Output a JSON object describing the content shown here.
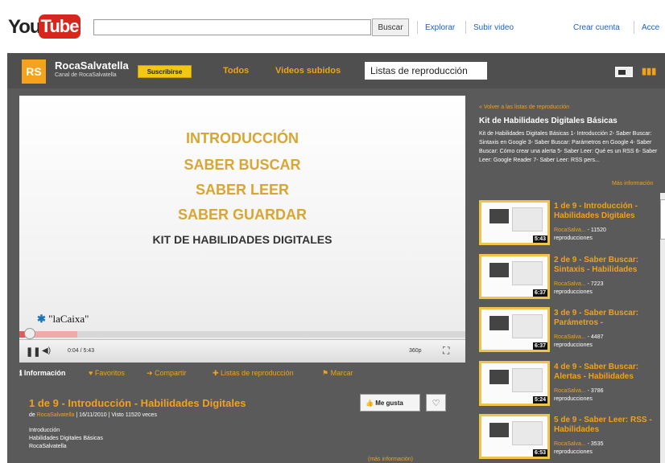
{
  "topbar": {
    "logo_you": "You",
    "logo_tube": "Tube",
    "search_placeholder": "",
    "search_button": "Buscar",
    "links": [
      "Explorar",
      "Subir video"
    ],
    "right_links": [
      "Crear cuenta",
      "Acce"
    ]
  },
  "channel": {
    "logo": "RS",
    "name": "RocaSalvatella",
    "subtitle": "Canal de RocaSalvatella",
    "subscribe": "Suscribirse",
    "tabs": [
      "Todos",
      "Videos subidos",
      "Listas de reproducción"
    ]
  },
  "player": {
    "titles": [
      "INTRODUCCIÓN",
      "SABER BUSCAR",
      "SABER LEER",
      "SABER GUARDAR"
    ],
    "kit": "KIT DE HABILIDADES DIGITALES",
    "sponsor": "\"laCaixa\"",
    "time": "0:04 / 5:43",
    "quality": "360p",
    "progress_fraction": 0.012,
    "buffer_fraction": 0.13
  },
  "actions": [
    {
      "icon": "info-icon",
      "label": "Información"
    },
    {
      "icon": "heart-icon",
      "label": "Favoritos"
    },
    {
      "icon": "arrow-icon",
      "label": "Compartir"
    },
    {
      "icon": "plus-icon",
      "label": "Listas de reproducción"
    },
    {
      "icon": "flag-icon",
      "label": "Marcar"
    }
  ],
  "video": {
    "title": "1 de 9 - Introducción - Habilidades Digitales",
    "meta_prefix": "de",
    "meta_author": "RocaSalvatella",
    "meta_rest": "| 16/11/2010 | Visto 11520 veces",
    "desc": [
      "Introducción",
      "Habilidades Digitales Básicas",
      "RocaSalvatella"
    ],
    "like": "Me gusta",
    "more": "(más información)"
  },
  "playlist": {
    "back": "« Volver a las listas de reproducción",
    "title": "Kit de Habilidades Digitales Básicas",
    "desc": "Kit de Habilidades Digitales Básicas 1- Introducción 2- Saber Buscar: Sintaxis en Google 3- Saber Buscar: Parámetros en Google 4- Saber Buscar: Cómo crear una alerta 5- Saber Leer: Qué es un RSS 6- Saber Leer: Google Reader 7- Saber Leer: RSS pers...",
    "more": "Más información",
    "items": [
      {
        "title": "1 de 9 - Introducción - Habilidades Digitales",
        "author": "RocaSalva...",
        "views": "- 11520",
        "views_label": "reproducciones",
        "duration": "5:43"
      },
      {
        "title": "2 de 9 - Saber Buscar: Sintaxis - Habilidades",
        "author": "RocaSalva...",
        "views": "- 7223",
        "views_label": "reproducciones",
        "duration": "6:37"
      },
      {
        "title": "3 de 9 - Saber Buscar: Parámetros -",
        "author": "RocaSalva...",
        "views": "- 4487",
        "views_label": "reproducciones",
        "duration": "6:37"
      },
      {
        "title": "4 de 9 - Saber Buscar: Alertas - Habilidades",
        "author": "RocaSalva...",
        "views": "- 3786",
        "views_label": "reproducciones",
        "duration": "5:24"
      },
      {
        "title": "5 de 9 - Saber Leer: RSS - Habilidades",
        "author": "RocaSalva...",
        "views": "- 3535",
        "views_label": "reproducciones",
        "duration": "6:53"
      }
    ]
  },
  "colors": {
    "accent": "#f0a21b",
    "background": "#5a5a5a",
    "subscribe": "#f3c815"
  }
}
